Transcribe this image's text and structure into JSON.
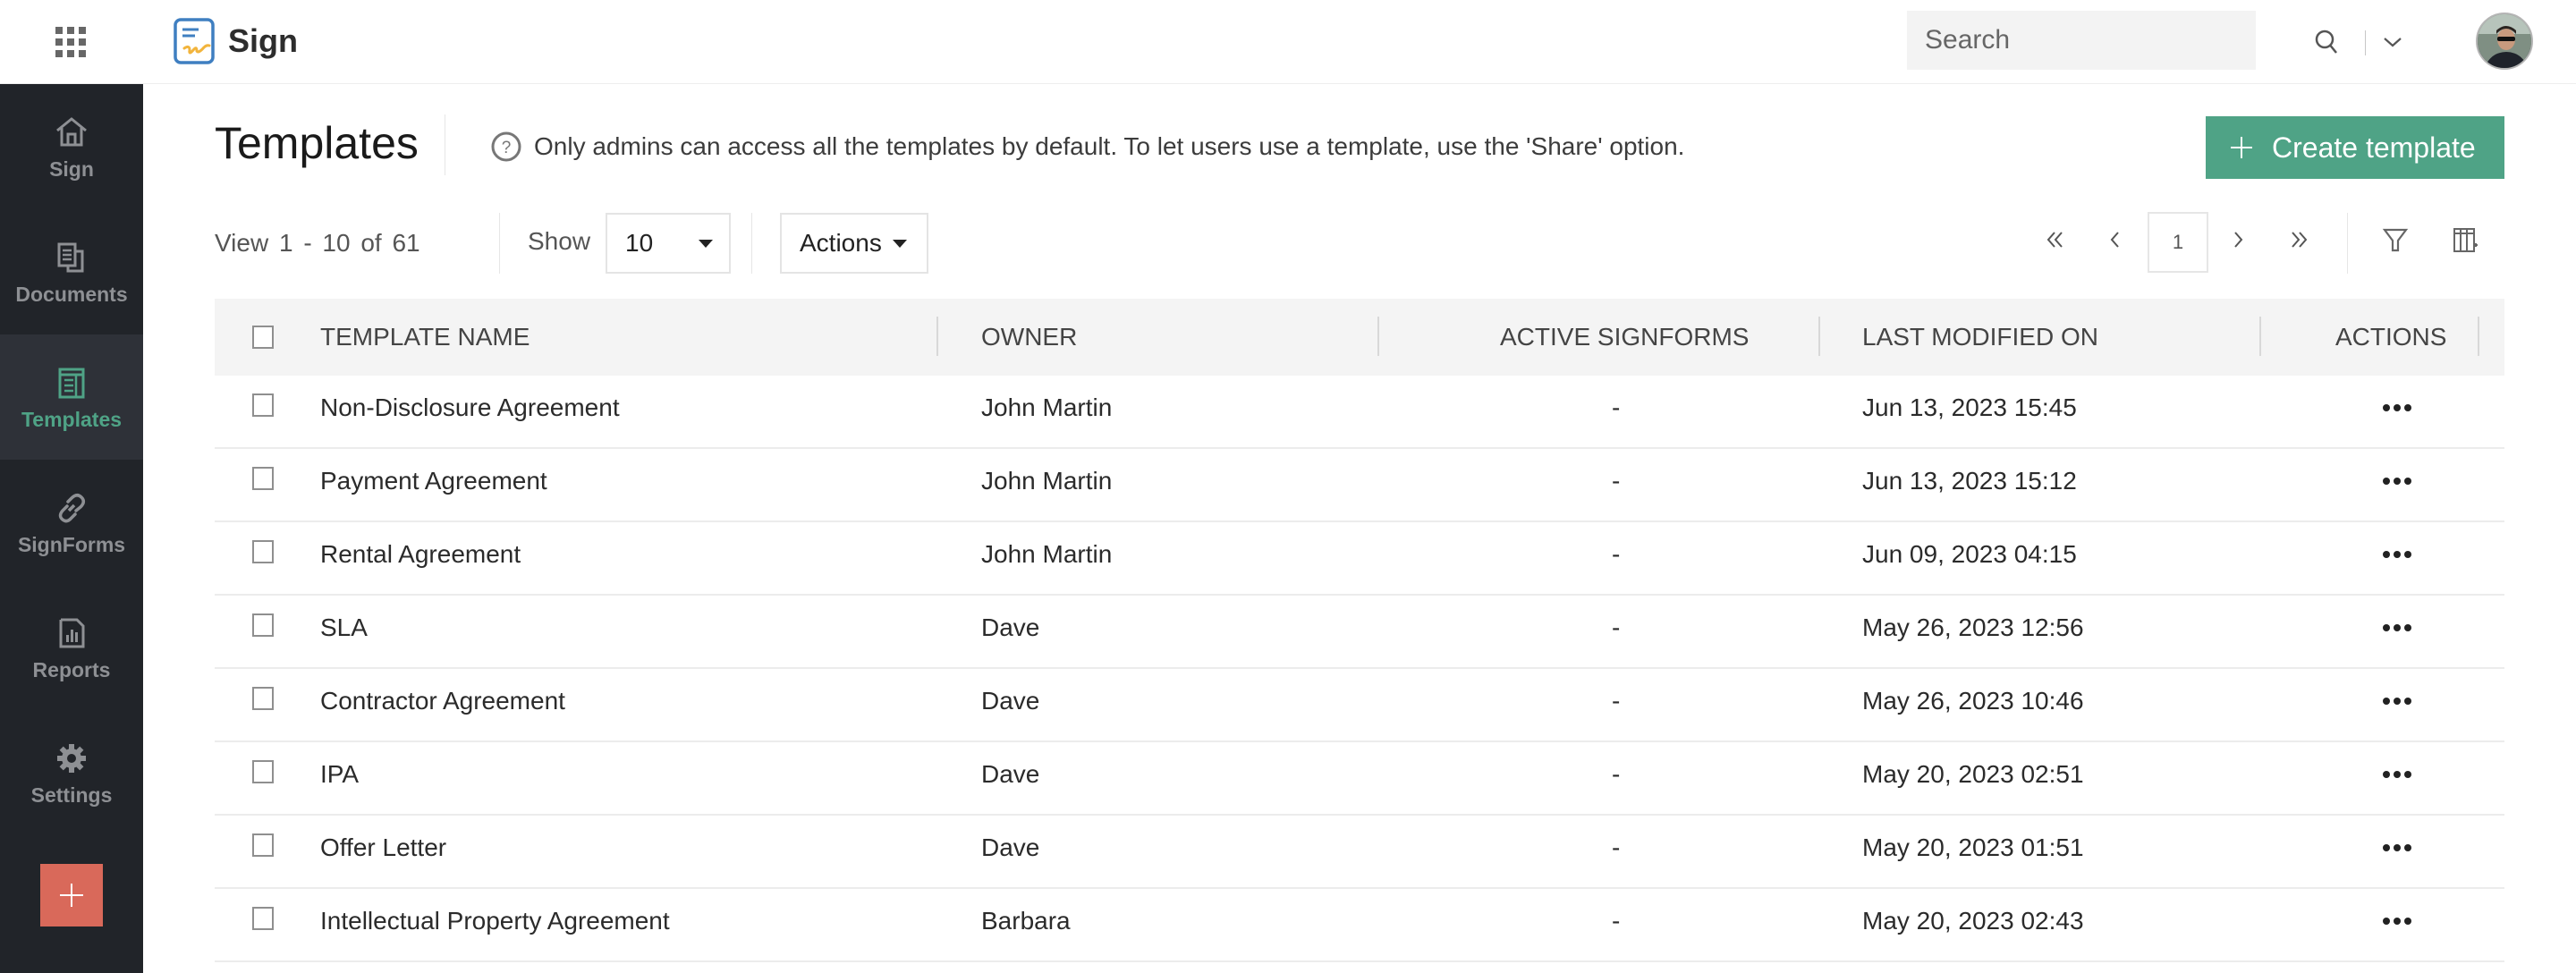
{
  "app": {
    "name": "Sign",
    "apps_icon": "grid-icon",
    "logo_icon": "sign-logo-icon"
  },
  "search": {
    "placeholder": "Search",
    "value": ""
  },
  "user": {
    "avatar": "user-avatar"
  },
  "sidebar": {
    "items": [
      {
        "label": "Sign",
        "icon": "home-icon",
        "active": false
      },
      {
        "label": "Documents",
        "icon": "documents-icon",
        "active": false
      },
      {
        "label": "Templates",
        "icon": "templates-icon",
        "active": true
      },
      {
        "label": "SignForms",
        "icon": "link-icon",
        "active": false
      },
      {
        "label": "Reports",
        "icon": "reports-icon",
        "active": false
      },
      {
        "label": "Settings",
        "icon": "gear-icon",
        "active": false
      }
    ],
    "new_button": "plus-icon"
  },
  "page": {
    "title": "Templates",
    "info_text": "Only admins can access all the templates by default. To let users use a template, use the 'Share' option.",
    "create_button": "Create template"
  },
  "toolbar": {
    "view_text": "View 1 - 10 of 61",
    "show_label": "Show",
    "page_size": "10",
    "actions_label": "Actions",
    "current_page": "1"
  },
  "colors": {
    "accent": "#4fa386",
    "sidebar_bg": "#212429",
    "sidebar_active_bg": "#2e3138",
    "new_button": "#d9695a"
  },
  "table": {
    "columns": [
      "TEMPLATE NAME",
      "OWNER",
      "ACTIVE SIGNFORMS",
      "LAST MODIFIED ON",
      "ACTIONS"
    ],
    "rows": [
      {
        "name": "Non-Disclosure Agreement",
        "owner": "John Martin",
        "active_signforms": "-",
        "last_modified": "Jun 13, 2023 15:45"
      },
      {
        "name": "Payment Agreement",
        "owner": "John Martin",
        "active_signforms": "-",
        "last_modified": "Jun 13, 2023 15:12"
      },
      {
        "name": "Rental Agreement",
        "owner": "John Martin",
        "active_signforms": "-",
        "last_modified": "Jun 09, 2023 04:15"
      },
      {
        "name": "SLA",
        "owner": "Dave",
        "active_signforms": "-",
        "last_modified": "May 26, 2023 12:56"
      },
      {
        "name": "Contractor Agreement",
        "owner": "Dave",
        "active_signforms": "-",
        "last_modified": "May 26, 2023 10:46"
      },
      {
        "name": "IPA",
        "owner": "Dave",
        "active_signforms": "-",
        "last_modified": "May 20, 2023 02:51"
      },
      {
        "name": "Offer Letter",
        "owner": "Dave",
        "active_signforms": "-",
        "last_modified": "May 20, 2023 01:51"
      },
      {
        "name": "Intellectual Property Agreement",
        "owner": "Barbara",
        "active_signforms": "-",
        "last_modified": "May 20, 2023 02:43"
      }
    ]
  }
}
